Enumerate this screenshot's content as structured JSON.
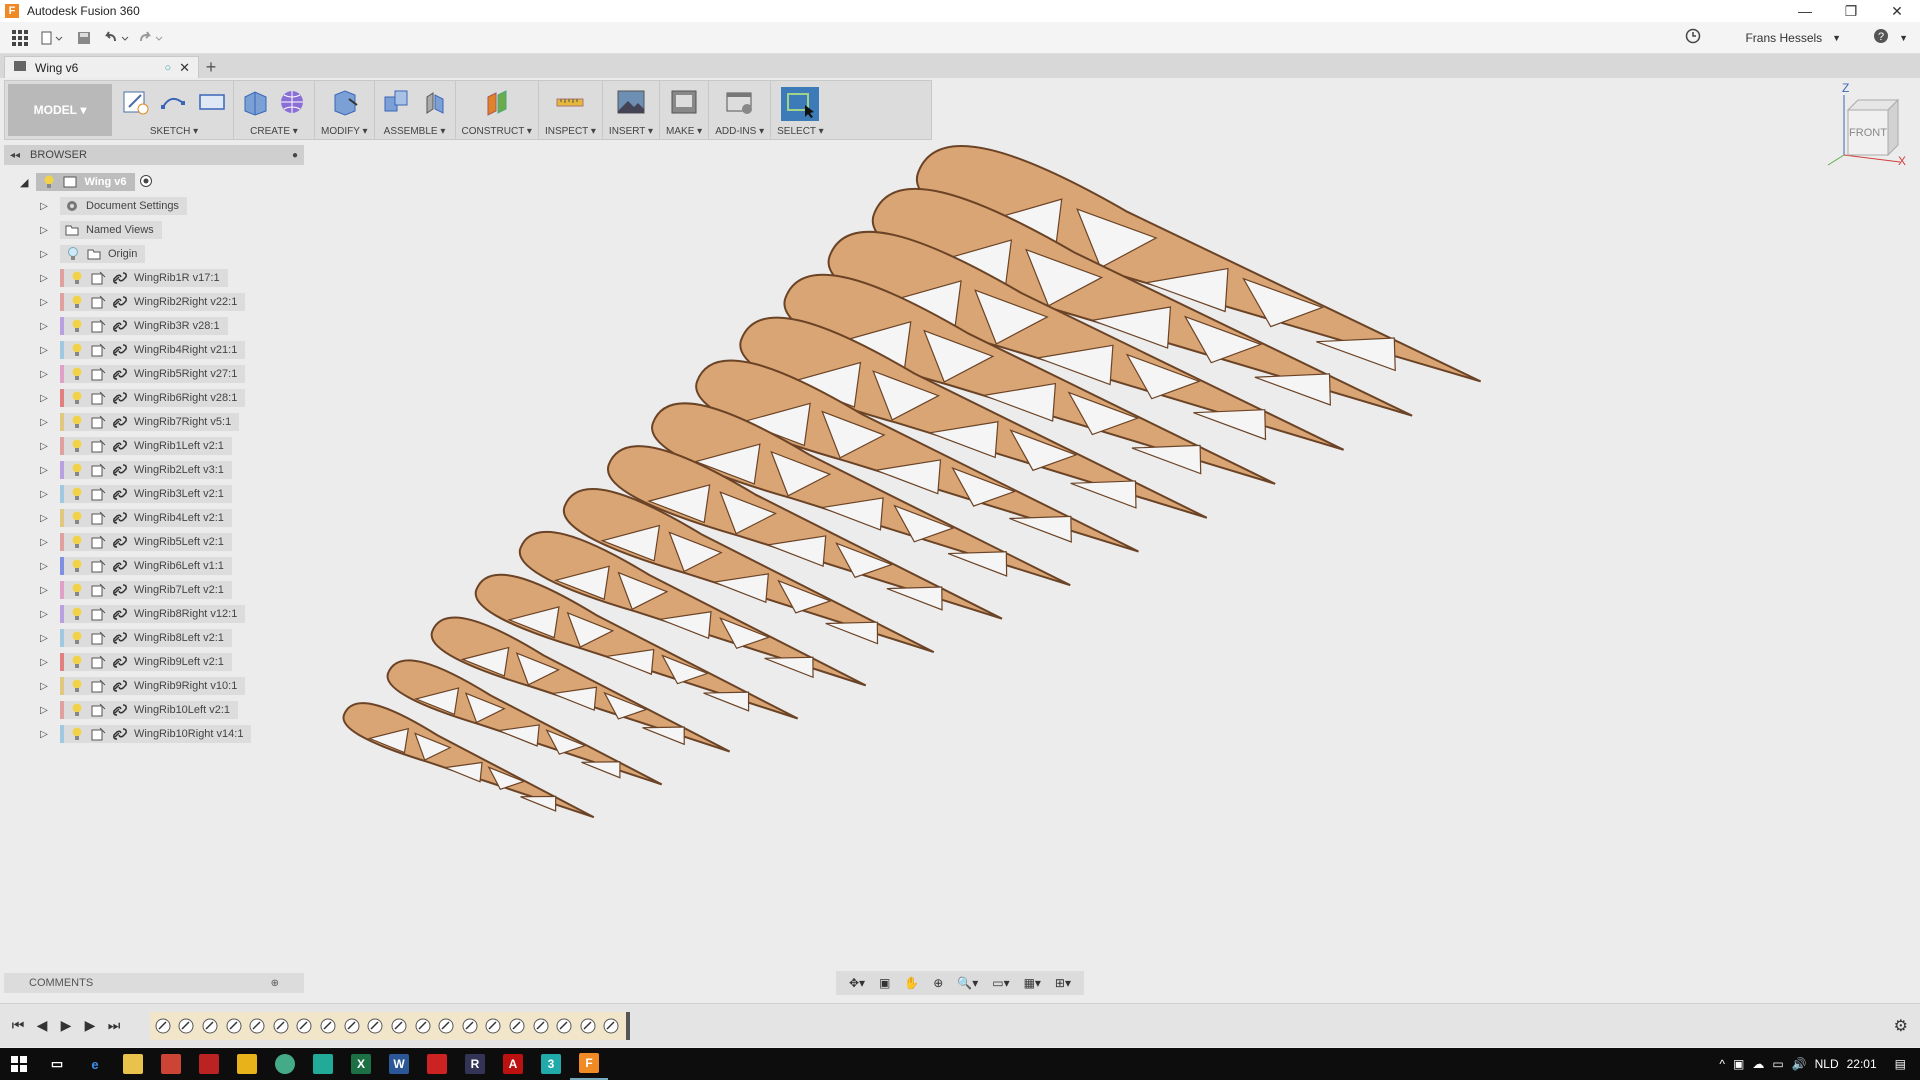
{
  "window": {
    "title": "Autodesk Fusion 360"
  },
  "quick_access": {
    "user_name": "Frans Hessels"
  },
  "tabs": [
    {
      "label": "Wing v6"
    }
  ],
  "toolbar": {
    "workspace": "MODEL",
    "groups": [
      {
        "label": "SKETCH"
      },
      {
        "label": "CREATE"
      },
      {
        "label": "MODIFY"
      },
      {
        "label": "ASSEMBLE"
      },
      {
        "label": "CONSTRUCT"
      },
      {
        "label": "INSPECT"
      },
      {
        "label": "INSERT"
      },
      {
        "label": "MAKE"
      },
      {
        "label": "ADD-INS"
      },
      {
        "label": "SELECT"
      }
    ]
  },
  "browser": {
    "header": "BROWSER",
    "root": "Wing v6",
    "folders": [
      {
        "label": "Document Settings",
        "icon": "gear-icon"
      },
      {
        "label": "Named Views",
        "icon": "folder-icon"
      },
      {
        "label": "Origin",
        "icon": "folder-icon"
      }
    ],
    "components": [
      {
        "label": "WingRib1R v17:1",
        "color": "#e0a0a0"
      },
      {
        "label": "WingRib2Right v22:1",
        "color": "#e0a0a0"
      },
      {
        "label": "WingRib3R v28:1",
        "color": "#b9a0e0"
      },
      {
        "label": "WingRib4Right v21:1",
        "color": "#a0c8e0"
      },
      {
        "label": "WingRib5Right v27:1",
        "color": "#e0a0c8"
      },
      {
        "label": "WingRib6Right v28:1",
        "color": "#e08080"
      },
      {
        "label": "WingRib7Right v5:1",
        "color": "#e0c880"
      },
      {
        "label": "WingRib1Left v2:1",
        "color": "#e0a0a0"
      },
      {
        "label": "WingRib2Left v3:1",
        "color": "#b9a0e0"
      },
      {
        "label": "WingRib3Left v2:1",
        "color": "#a0c8e0"
      },
      {
        "label": "WingRib4Left v2:1",
        "color": "#e0c880"
      },
      {
        "label": "WingRib5Left v2:1",
        "color": "#e0a0a0"
      },
      {
        "label": "WingRib6Left v1:1",
        "color": "#8090e0"
      },
      {
        "label": "WingRib7Left v2:1",
        "color": "#e0a0c8"
      },
      {
        "label": "WingRib8Right v12:1",
        "color": "#b9a0e0"
      },
      {
        "label": "WingRib8Left v2:1",
        "color": "#a0c8e0"
      },
      {
        "label": "WingRib9Left v2:1",
        "color": "#e08080"
      },
      {
        "label": "WingRib9Right v10:1",
        "color": "#e0c880"
      },
      {
        "label": "WingRib10Left v2:1",
        "color": "#e0a0a0"
      },
      {
        "label": "WingRib10Right v14:1",
        "color": "#a0c8e0"
      }
    ]
  },
  "comments": {
    "label": "COMMENTS"
  },
  "viewcube": {
    "face": "FRONT",
    "axis_z": "Z",
    "axis_x": "X"
  },
  "taskbar": {
    "lang": "NLD",
    "time": "22:01"
  }
}
